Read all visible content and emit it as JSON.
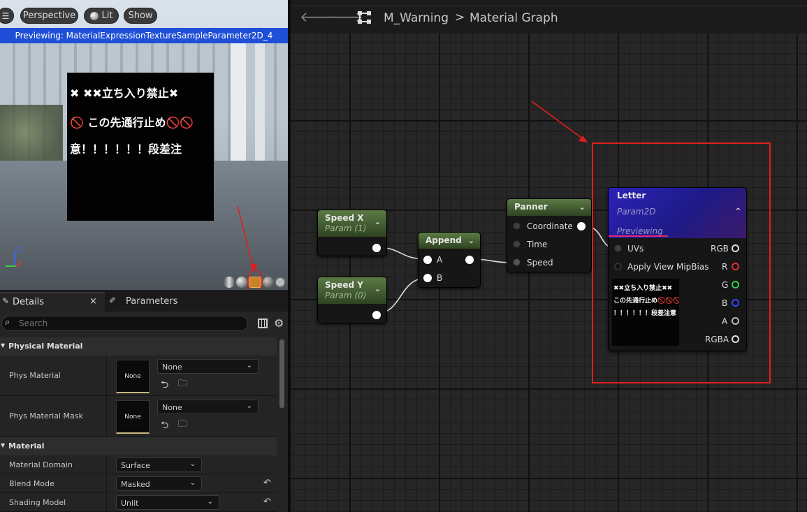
{
  "viewport": {
    "buttons": {
      "perspective": "Perspective",
      "lit": "Lit",
      "show": "Show"
    },
    "preview_banner": "Previewing: MaterialExpressionTextureSampleParameter2D_4",
    "sign_lines": [
      "✖ ✖✖立ち入り禁止✖",
      "🚫 この先通行止め🚫🚫",
      "意！！！！！！段差注"
    ],
    "axis": {
      "z": "Z",
      "x": "X"
    }
  },
  "details": {
    "tab_details": "Details",
    "tab_close": "×",
    "tab_parameters": "Parameters",
    "search_placeholder": "Search",
    "cat_physical": "Physical Material",
    "phys_material": "Phys Material",
    "phys_material_mask": "Phys Material Mask",
    "none_thumb": "None",
    "none_select": "None",
    "cat_material": "Material",
    "material_domain": "Material Domain",
    "material_domain_value": "Surface",
    "blend_mode": "Blend Mode",
    "blend_mode_value": "Masked",
    "shading_model": "Shading Model",
    "shading_model_value": "Unlit"
  },
  "graph": {
    "breadcrumb_asset": "M_Warning",
    "breadcrumb_sep": ">",
    "breadcrumb_graph": "Material Graph",
    "nodes": {
      "speed_x": {
        "title": "Speed X",
        "sub": "Param (1)"
      },
      "speed_y": {
        "title": "Speed Y",
        "sub": "Param (0)"
      },
      "append": {
        "title": "Append",
        "pin_a": "A",
        "pin_b": "B"
      },
      "panner": {
        "title": "Panner",
        "pin_coordinate": "Coordinate",
        "pin_time": "Time",
        "pin_speed": "Speed"
      },
      "letter": {
        "title": "Letter",
        "sub": "Param2D",
        "previewing": "Previewing",
        "in_uvs": "UVs",
        "in_mip": "Apply View MipBias",
        "out_rgb": "RGB",
        "out_r": "R",
        "out_g": "G",
        "out_b": "B",
        "out_a": "A",
        "out_rgba": "RGBA",
        "tex_lines": [
          "✖✖立ち入り禁止✖✖",
          "この先通行止め🚫🚫🚫",
          "！！！！！！段差注意"
        ]
      }
    }
  },
  "colors": {
    "accent": "#1f4fd8",
    "annotation_red": "#e01e1e",
    "node_green": "#4a6a35",
    "letter_header": "#2a1fa8"
  }
}
